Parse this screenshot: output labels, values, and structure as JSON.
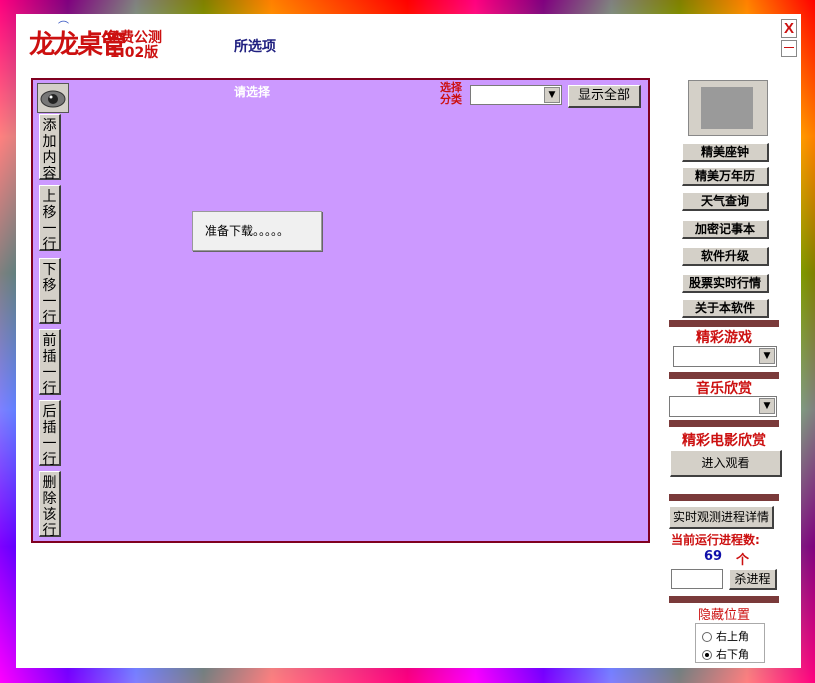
{
  "app": {
    "logo_text": "龙龙桌管",
    "beta_line1": "免费公测",
    "beta_line2": "1.02版",
    "selected_label": "所选项",
    "close_label": "X",
    "minimize_label": "—"
  },
  "main_panel": {
    "title": "请选择",
    "category_label_line1": "选择",
    "category_label_line2": "分类",
    "category_value": "",
    "show_all_label": "显示全部",
    "loading_text": "准备下载。。。。。"
  },
  "left_toolbar": [
    {
      "label": "添加内容"
    },
    {
      "label": "上移一行"
    },
    {
      "label": "下移一行"
    },
    {
      "label": "前插一行"
    },
    {
      "label": "后插一行"
    },
    {
      "label": "删除该行"
    }
  ],
  "side_buttons": [
    {
      "label": "精美座钟"
    },
    {
      "label": "精美万年历"
    },
    {
      "label": "天气查询"
    },
    {
      "label": "加密记事本"
    },
    {
      "label": "软件升级"
    },
    {
      "label": "股票实时行情"
    },
    {
      "label": "关于本软件"
    }
  ],
  "games": {
    "title": "精彩游戏",
    "value": ""
  },
  "music": {
    "title": "音乐欣赏",
    "value": ""
  },
  "movies": {
    "title": "精彩电影欣赏",
    "enter_label": "进入观看"
  },
  "process": {
    "detail_label": "实时观测进程详情",
    "count_label": "当前运行进程数:",
    "count": "69",
    "unit": "个",
    "kill_value": "",
    "kill_label": "杀进程"
  },
  "hide_position": {
    "title": "隐藏位置",
    "options": [
      {
        "label": "右上角",
        "checked": false
      },
      {
        "label": "右下角",
        "checked": true
      }
    ]
  }
}
